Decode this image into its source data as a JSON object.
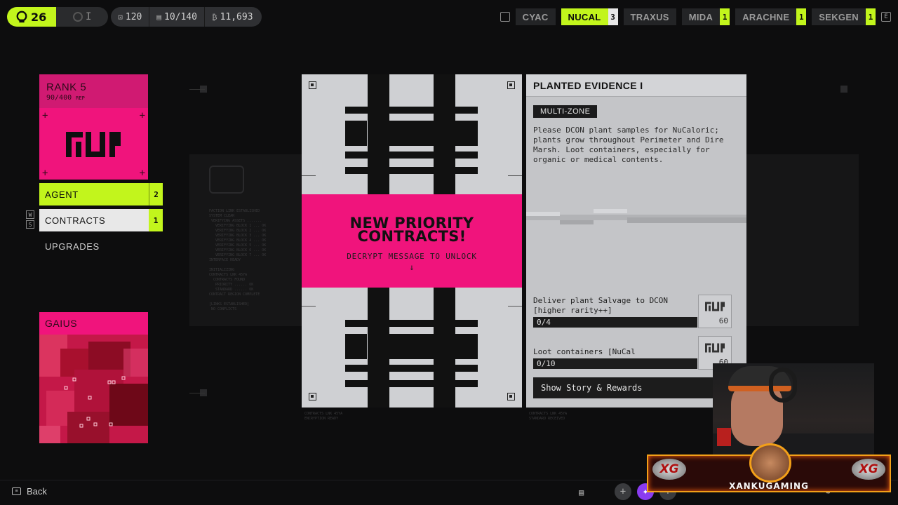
{
  "topbar": {
    "level": "26",
    "rank_glyph": "I",
    "stats": [
      {
        "icon": "container-icon",
        "glyph": "⊡",
        "value": "120"
      },
      {
        "icon": "backpack-icon",
        "glyph": "▤",
        "value": "10/140"
      },
      {
        "icon": "credits-icon",
        "glyph": "₿",
        "value": "11,693"
      }
    ]
  },
  "factions": {
    "prev_key": "Q",
    "next_key": "E",
    "items": [
      {
        "name": "CYAC",
        "count": ""
      },
      {
        "name": "NUCAL",
        "count": "3",
        "active": true
      },
      {
        "name": "TRAXUS",
        "count": ""
      },
      {
        "name": "MIDA",
        "count": "1"
      },
      {
        "name": "ARACHNE",
        "count": "1"
      },
      {
        "name": "SEKGEN",
        "count": "1"
      }
    ]
  },
  "rank_card": {
    "rank": "RANK 5",
    "rep": "90/400",
    "rep_unit": "REP"
  },
  "menu": {
    "keys": [
      "W",
      "S"
    ],
    "items": [
      {
        "label": "AGENT",
        "count": "2"
      },
      {
        "label": "CONTRACTS",
        "count": "1"
      },
      {
        "label": "UPGRADES",
        "count": ""
      }
    ]
  },
  "handler": {
    "name": "GAIUS"
  },
  "encrypted": {
    "headline": "NEW PRIORITY CONTRACTS!",
    "subtext": "DECRYPT MESSAGE TO UNLOCK",
    "arrow": "↓"
  },
  "contract": {
    "title": "PLANTED EVIDENCE I",
    "tag": "MULTI-ZONE",
    "description": "Please DCON plant samples for NuCaloric; plants grow throughout Perimeter and Dire Marsh. Loot containers, especially for organic or medical contents.",
    "objectives": [
      {
        "text": "Deliver plant Salvage to DCON [higher rarity++]",
        "progress": "0/4",
        "reward": "60"
      },
      {
        "text": "Loot containers [NuCal preferred++]",
        "progress": "0/10",
        "reward": "60"
      }
    ],
    "show_button": "Show Story & Rewards"
  },
  "bottombar": {
    "back_label": "Back",
    "back_key": "Esc"
  },
  "stream": {
    "channel": "XANKUGAMING",
    "badge": "XG"
  },
  "colors": {
    "accent_lime": "#c2f51c",
    "accent_pink": "#f0147c",
    "panel_light": "#cfd0d3"
  }
}
